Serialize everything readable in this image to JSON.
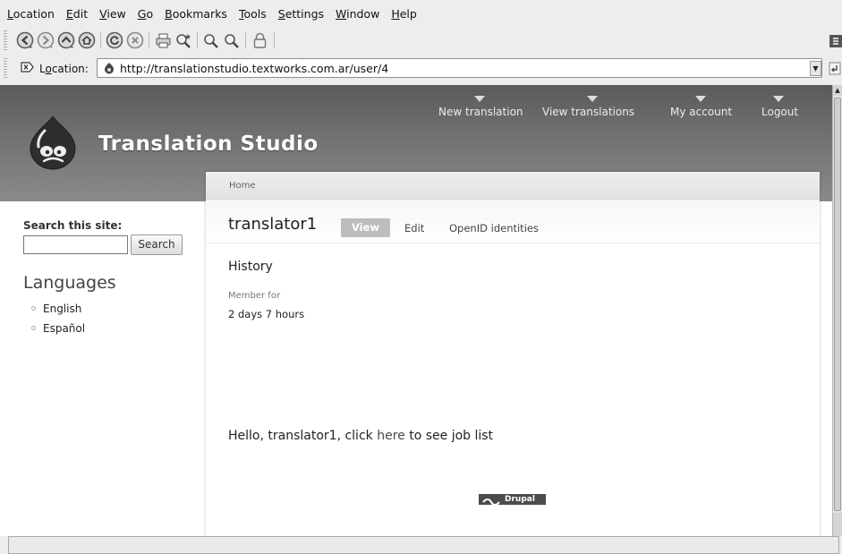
{
  "menu": {
    "items": [
      {
        "accel": "L",
        "rest": "ocation"
      },
      {
        "accel": "E",
        "rest": "dit"
      },
      {
        "accel": "V",
        "rest": "iew"
      },
      {
        "accel": "G",
        "rest": "o"
      },
      {
        "accel": "B",
        "rest": "ookmarks"
      },
      {
        "accel": "T",
        "rest": "ools"
      },
      {
        "accel": "S",
        "rest": "ettings"
      },
      {
        "accel": "W",
        "rest": "indow"
      },
      {
        "accel": "H",
        "rest": "elp"
      }
    ]
  },
  "toolbar": {
    "buttons": [
      "back-icon",
      "forward-icon",
      "up-icon",
      "home-icon",
      "reload-icon",
      "stop-icon",
      "print-icon",
      "find-icon",
      "zoom-in-icon",
      "zoom-out-icon",
      "security-lock-icon"
    ]
  },
  "location": {
    "label_accel": "o",
    "label_pre": "L",
    "label_post": "cation:",
    "url": "http://translationstudio.textworks.com.ar/user/4"
  },
  "site": {
    "name": "Translation Studio",
    "primary_links": [
      "New translation",
      "View translations",
      "My account",
      "Logout"
    ],
    "colors": {
      "header": "#6f6f6f",
      "tab_active": "#bdbdbd"
    }
  },
  "sidebar": {
    "search_label": "Search this site:",
    "search_value": "",
    "search_button": "Search",
    "languages_title": "Languages",
    "languages": [
      "English",
      "Español"
    ]
  },
  "content": {
    "breadcrumb": "Home",
    "title": "translator1",
    "tabs": {
      "view": "View",
      "edit": "Edit",
      "openid": "OpenID identities"
    },
    "history": "History",
    "member_label": "Member for",
    "member_value": "2 days 7 hours",
    "hello_pre": "Hello, translator1, click ",
    "hello_link": "here",
    "hello_post": " to see job list",
    "powered_by": "Drupal"
  }
}
